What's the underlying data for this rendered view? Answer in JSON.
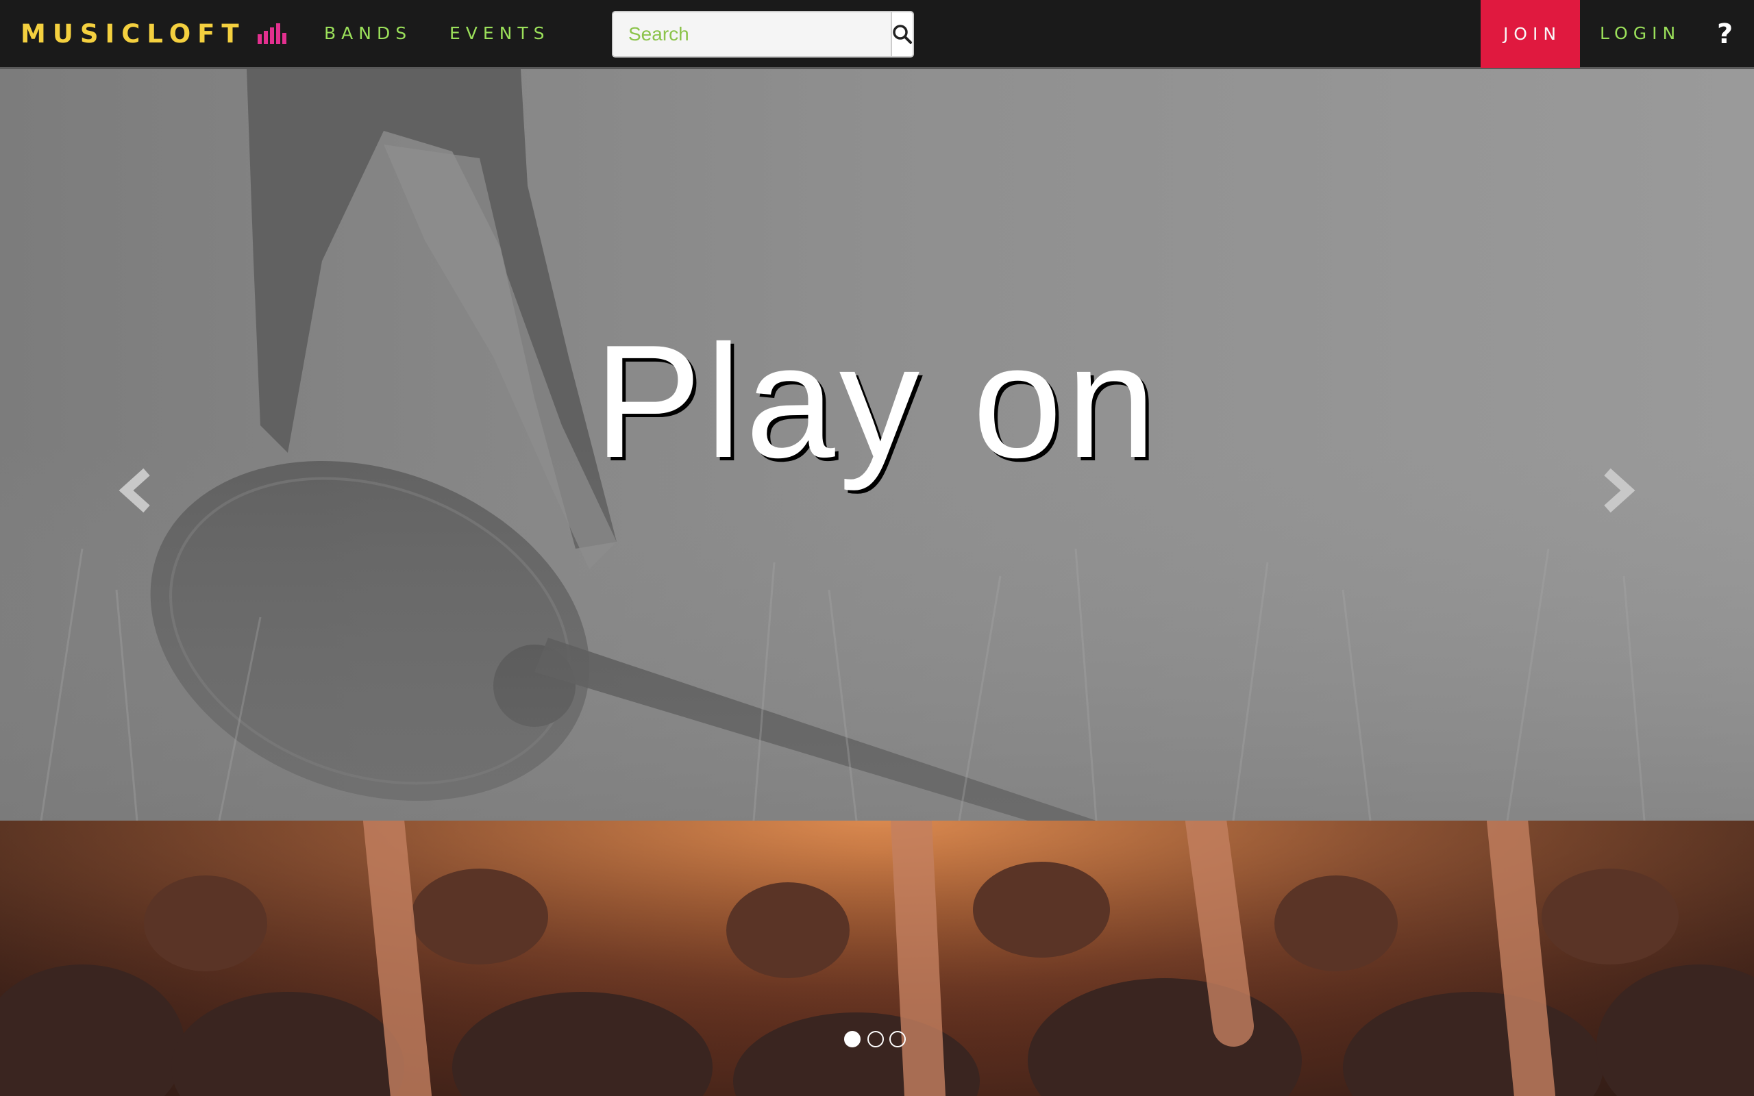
{
  "navbar": {
    "brand": "MUSICLOFT",
    "links": {
      "bands": "BANDS",
      "events": "EVENTS"
    },
    "search": {
      "placeholder": "Search",
      "value": ""
    },
    "join_label": "JOIN",
    "login_label": "LOGIN",
    "help_label": "?"
  },
  "carousel": {
    "caption": "Play on",
    "active_slide": 1,
    "slide_count": 3
  },
  "icons": {
    "brand_bars": "equalizer-bars-icon",
    "search": "magnifier-icon",
    "prev": "chevron-left-icon",
    "next": "chevron-right-icon"
  },
  "colors": {
    "brand": "#f4d03f",
    "nav_link": "#9be05a",
    "join_bg": "#e0193f",
    "bars_icon": "#e3308f",
    "navbar_bg": "#1a1a1a"
  }
}
